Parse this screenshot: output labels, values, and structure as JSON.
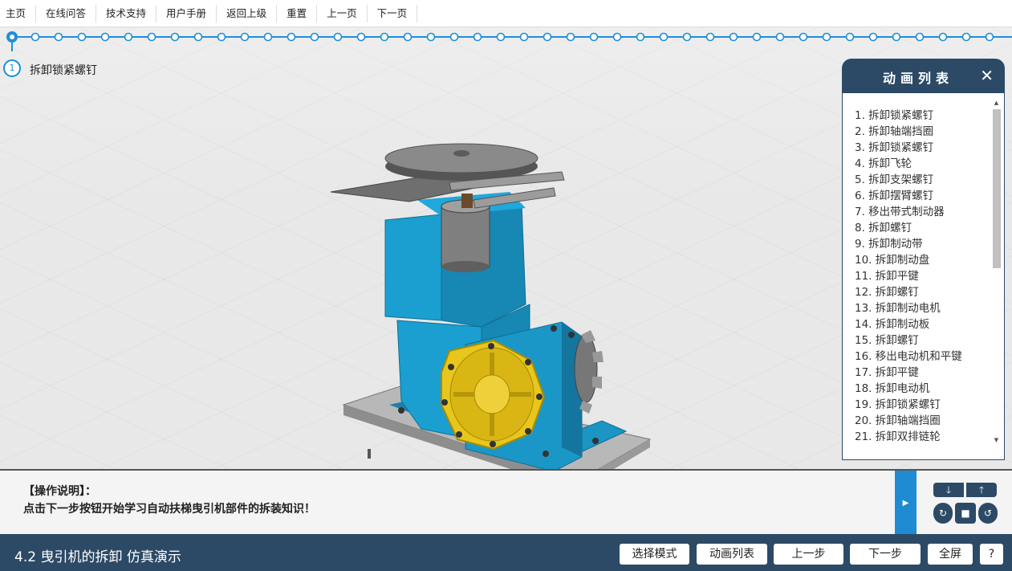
{
  "top_menu": {
    "items": [
      "主页",
      "在线问答",
      "技术支持",
      "用户手册",
      "返回上级",
      "重置",
      "上一页",
      "下一页"
    ]
  },
  "step": {
    "number": "1",
    "title": "拆卸锁紧螺钉"
  },
  "colors": {
    "accent": "#1d8fd9",
    "panel_header": "#2c4a66",
    "machine_blue": "#1a9fd0",
    "cover_yellow": "#e8c61c"
  },
  "anim_panel": {
    "title": "动画列表",
    "close_icon": "close-icon",
    "items": [
      "1. 拆卸锁紧螺钉",
      "2. 拆卸轴端挡圈",
      "3. 拆卸锁紧螺钉",
      "4. 拆卸飞轮",
      "5. 拆卸支架螺钉",
      "6. 拆卸摆臂螺钉",
      "7. 移出带式制动器",
      "8. 拆卸螺钉",
      "9. 拆卸制动带",
      "10. 拆卸制动盘",
      "11. 拆卸平键",
      "12. 拆卸螺钉",
      "13. 拆卸制动电机",
      "14. 拆卸制动板",
      "15. 拆卸螺钉",
      "16. 移出电动机和平键",
      "17. 拆卸平键",
      "18. 拆卸电动机",
      "19. 拆卸锁紧螺钉",
      "20. 拆卸轴端挡圈",
      "21. 拆卸双排链轮"
    ]
  },
  "instructions": {
    "label": "【操作说明】：",
    "text": "点击下一步按钮开始学习自动扶梯曳引机部件的拆装知识！"
  },
  "controls": {
    "play_icon": "play-icon",
    "camera_buttons": [
      "arrow-down-icon",
      "arrow-up-icon",
      "rotate-left-icon",
      "camera-icon",
      "rotate-right-icon"
    ]
  },
  "bottom_bar": {
    "title": "4.2 曳引机的拆卸 仿真演示",
    "buttons": {
      "select_mode": "选择模式",
      "anim_list": "动画列表",
      "prev": "上一步",
      "next": "下一步",
      "fullscreen": "全屏",
      "help": "?"
    }
  }
}
